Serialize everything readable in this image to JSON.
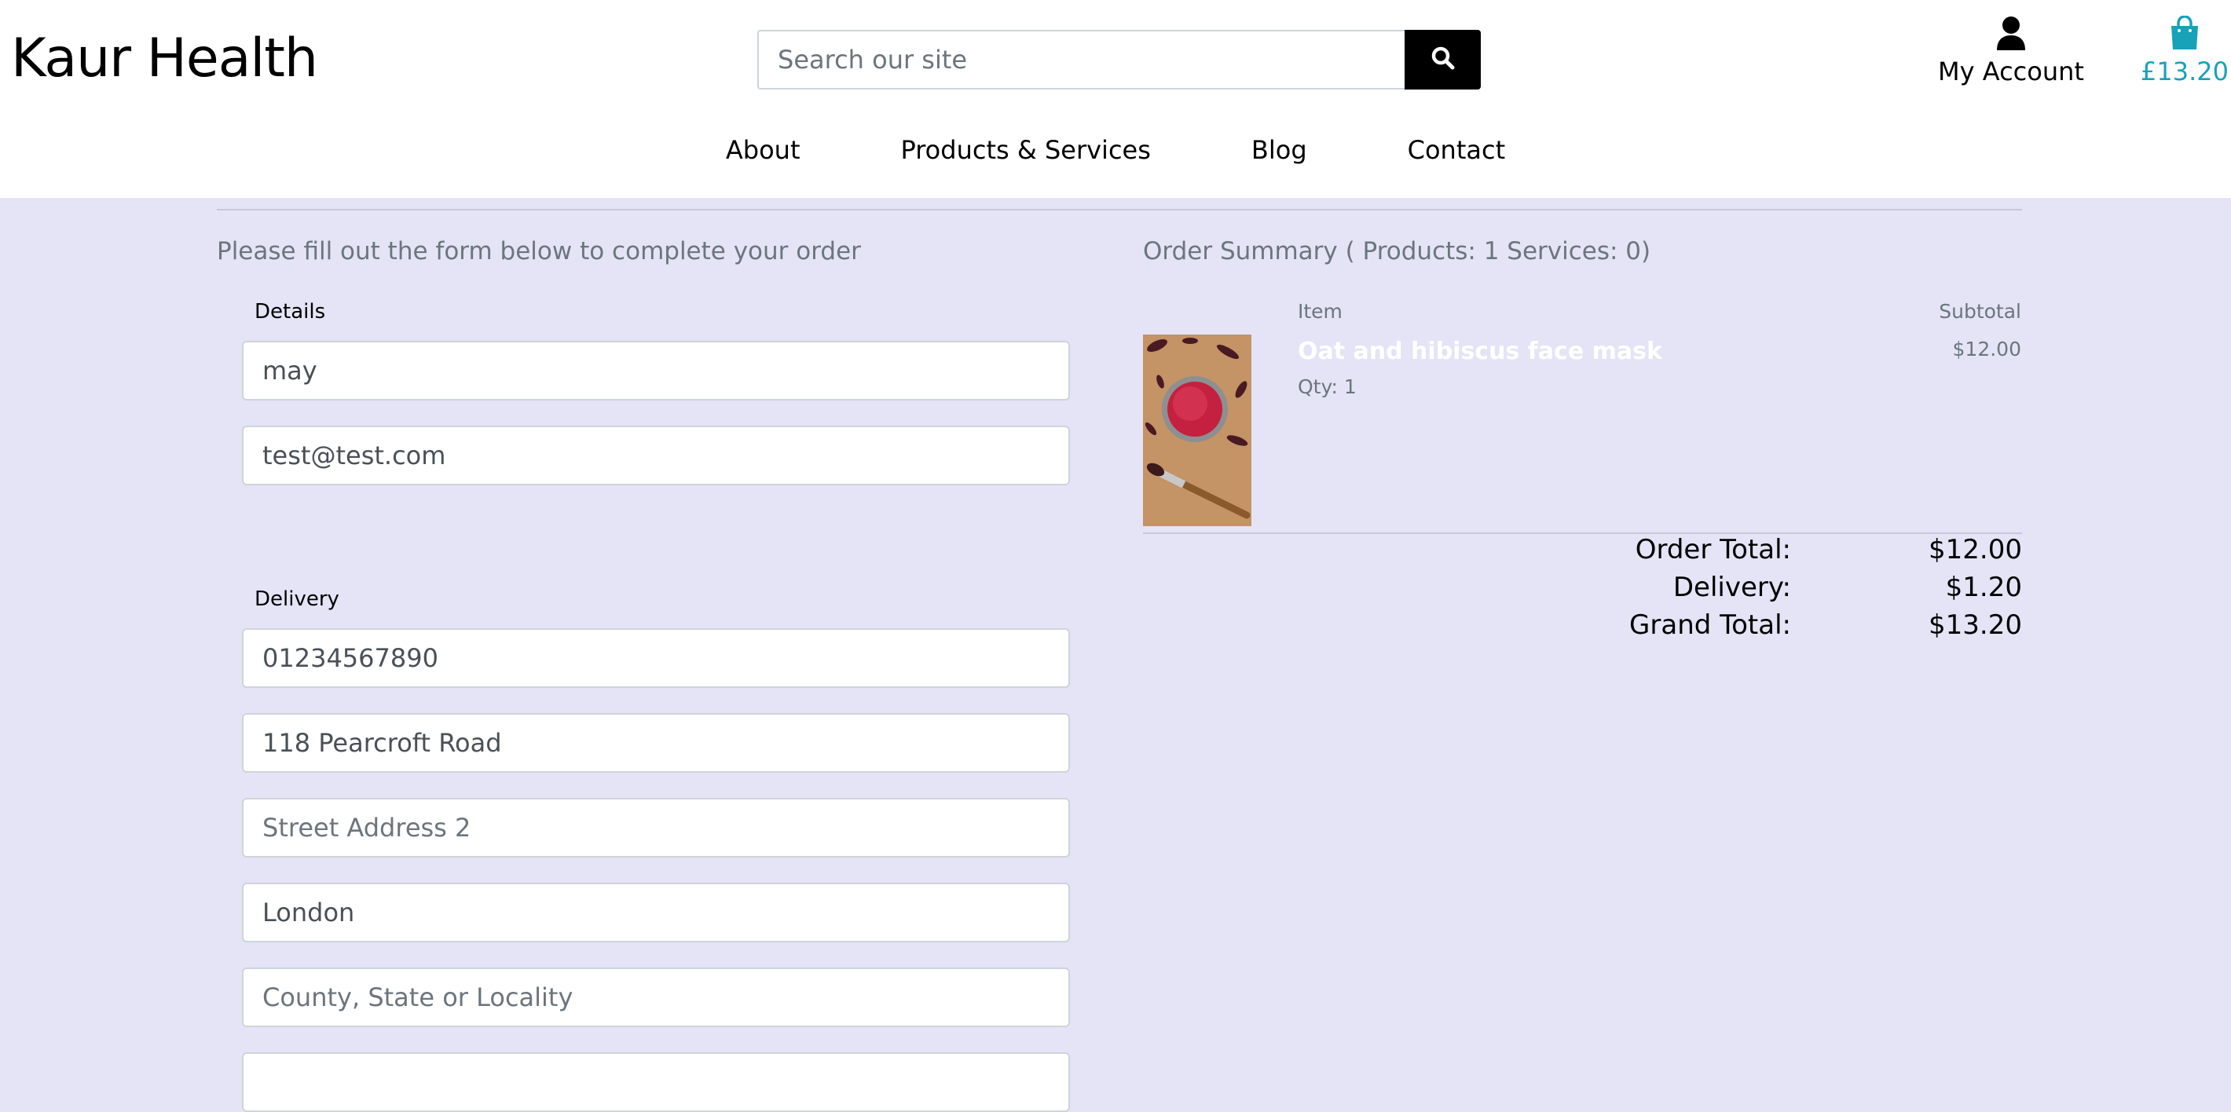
{
  "header": {
    "brand": "Kaur Health",
    "search_placeholder": "Search our site",
    "account_label": "My Account",
    "bag_total": "£13.20",
    "nav": [
      "About",
      "Products & Services",
      "Blog",
      "Contact"
    ]
  },
  "checkout": {
    "intro": "Please fill out the form below to complete your order",
    "details_label": "Details",
    "delivery_label": "Delivery",
    "fields": {
      "full_name": {
        "value": "may"
      },
      "email": {
        "value": "test@test.com"
      },
      "phone": {
        "value": "01234567890"
      },
      "street1": {
        "value": "118 Pearcroft Road"
      },
      "street2": {
        "placeholder": "Street Address 2"
      },
      "town": {
        "value": "London"
      },
      "county": {
        "placeholder": "County, State or Locality"
      }
    }
  },
  "summary": {
    "title": "Order Summary ( Products: 1 Services: 0)",
    "col_item": "Item",
    "col_subtotal": "Subtotal",
    "item": {
      "name": "Oat and hibiscus face mask",
      "qty": "Qty: 1",
      "subtotal": "$12.00"
    },
    "totals": [
      {
        "label": "Order Total:",
        "value": "$12.00"
      },
      {
        "label": "Delivery:",
        "value": "$1.20"
      },
      {
        "label": "Grand Total:",
        "value": "$13.20"
      }
    ]
  },
  "colors": {
    "page_bg": "#e4e4f6",
    "accent": "#17a2b8"
  },
  "icons": {
    "search": "search-icon",
    "account": "user-icon",
    "bag": "shopping-bag-icon"
  }
}
